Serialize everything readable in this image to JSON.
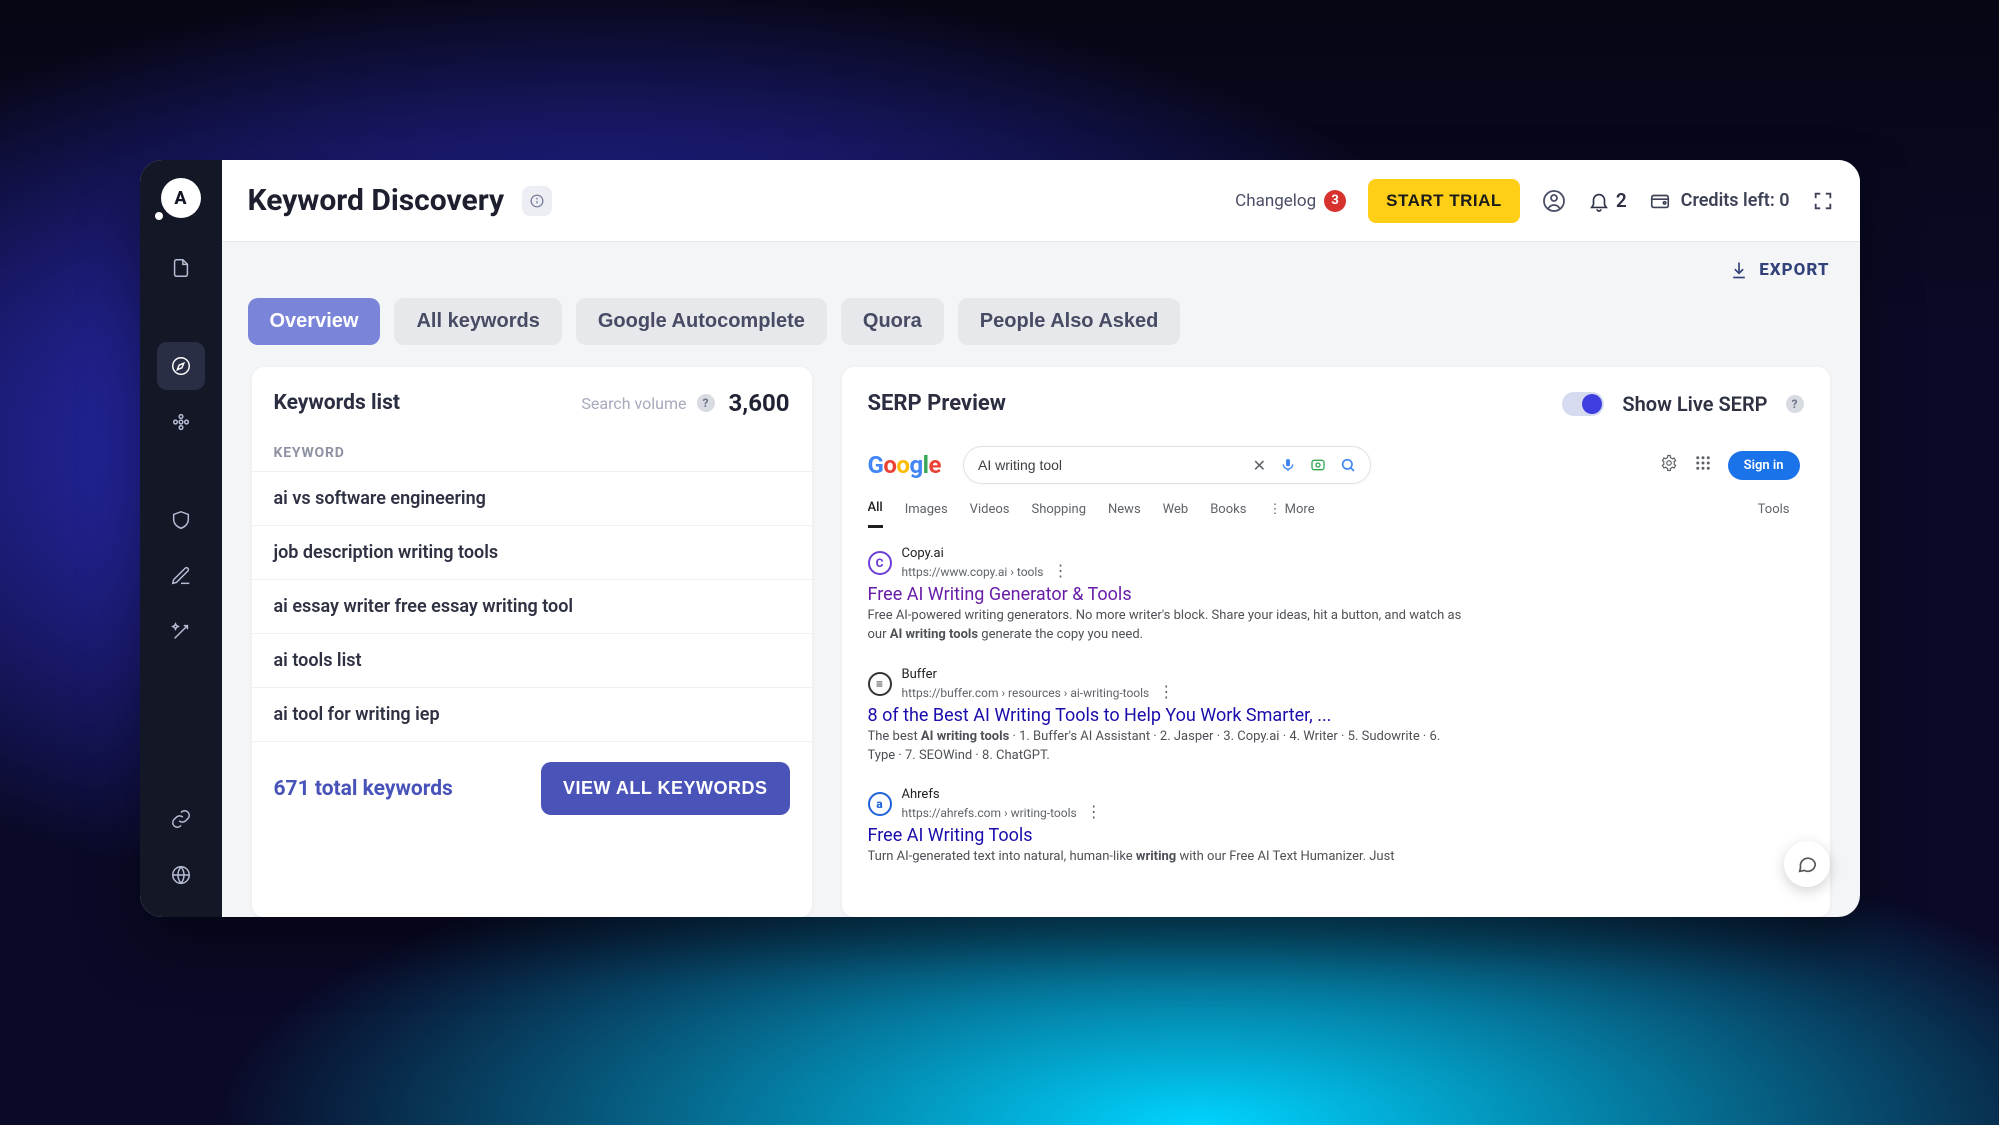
{
  "header": {
    "page_title": "Keyword Discovery",
    "changelog_label": "Changelog",
    "changelog_count": "3",
    "start_trial": "START TRIAL",
    "notifications_count": "2",
    "credits_label": "Credits left: 0"
  },
  "subbar": {
    "export": "EXPORT"
  },
  "tabs": [
    {
      "label": "Overview",
      "active": true
    },
    {
      "label": "All keywords",
      "active": false
    },
    {
      "label": "Google Autocomplete",
      "active": false
    },
    {
      "label": "Quora",
      "active": false
    },
    {
      "label": "People Also Asked",
      "active": false
    }
  ],
  "keywords": {
    "title": "Keywords list",
    "search_volume_label": "Search volume",
    "search_volume_value": "3,600",
    "column_header": "KEYWORD",
    "rows": [
      "ai vs software engineering",
      "job description writing tools",
      "ai essay writer free essay writing tool",
      "ai tools list",
      "ai tool for writing iep"
    ],
    "total_label": "671 total keywords",
    "view_all": "VIEW ALL KEYWORDS"
  },
  "serp": {
    "title": "SERP Preview",
    "live_label": "Show Live SERP",
    "search_value": "AI writing tool",
    "sign_in": "Sign in",
    "gtabs": [
      "All",
      "Images",
      "Videos",
      "Shopping",
      "News",
      "Web",
      "Books"
    ],
    "more": "More",
    "tools": "Tools",
    "results": [
      {
        "favicon_letter": "C",
        "favicon_color": "#6e3fd6",
        "source": "Copy.ai",
        "url": "https://www.copy.ai › tools",
        "title": "Free AI Writing Generator & Tools",
        "title_color": "purple",
        "snippet_html": "Free AI-powered writing generators. No more writer's block. Share your ideas, hit a button, and watch as our <b>AI writing tools</b> generate the copy you need."
      },
      {
        "favicon_letter": "≡",
        "favicon_color": "#333333",
        "source": "Buffer",
        "url": "https://buffer.com › resources › ai-writing-tools",
        "title": "8 of the Best AI Writing Tools to Help You Work Smarter, ...",
        "title_color": "blue",
        "snippet_html": "The best <b>AI writing tools</b> · 1. Buffer's AI Assistant · 2. Jasper · 3. Copy.ai · 4. Writer · 5. Sudowrite · 6. Type · 7. SEOWind · 8. ChatGPT."
      },
      {
        "favicon_letter": "a",
        "favicon_color": "#1e63d6",
        "source": "Ahrefs",
        "url": "https://ahrefs.com › writing-tools",
        "title": "Free AI Writing Tools",
        "title_color": "blue",
        "snippet_html": "Turn AI-generated text into natural, human-like <b>writing</b> with our Free AI Text Humanizer. Just"
      }
    ]
  }
}
